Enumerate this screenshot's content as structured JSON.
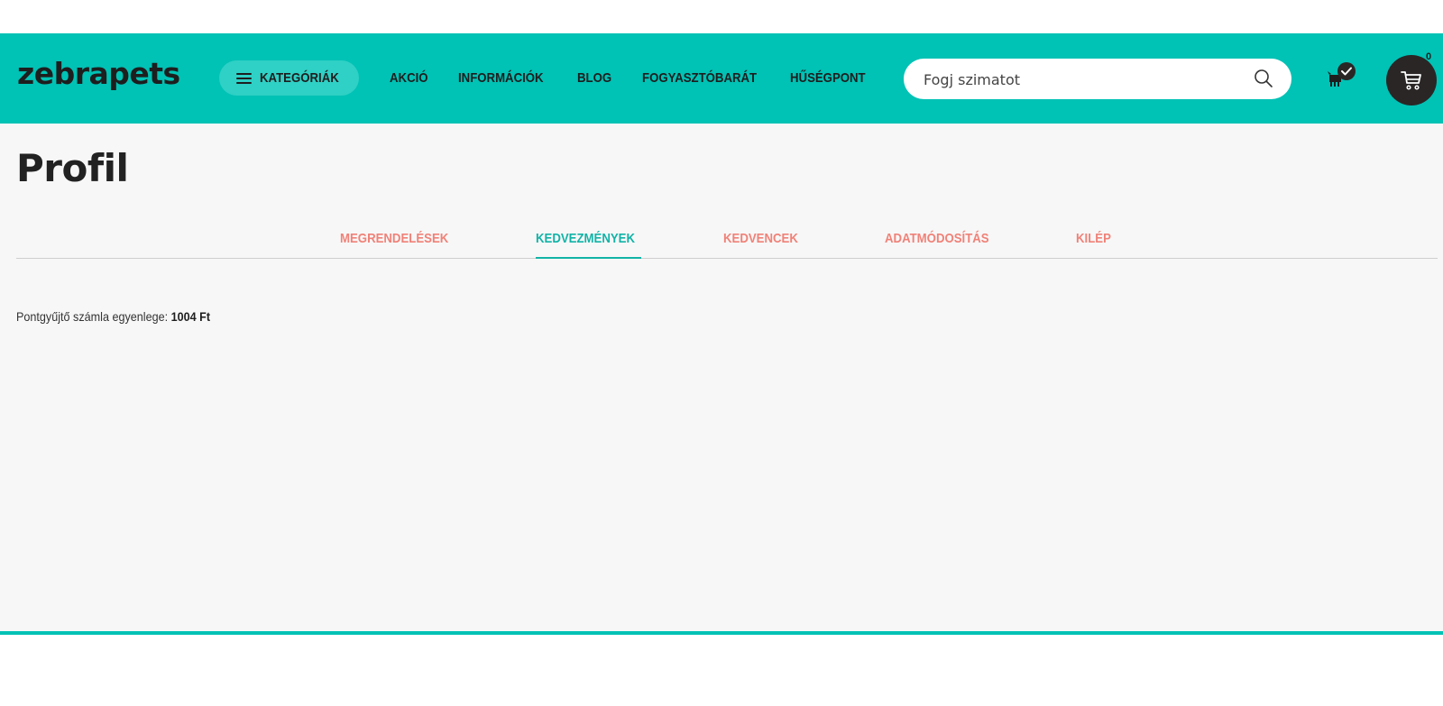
{
  "header": {
    "logo": "zebrapets",
    "categories_label": "KATEGÓRIÁK",
    "nav": [
      "AKCIÓ",
      "INFORMÁCIÓK",
      "BLOG",
      "FOGYASZTÓBARÁT",
      "HŰSÉGPONT"
    ],
    "search_placeholder": "Fogj szimatot",
    "cart_count": "0"
  },
  "profile": {
    "title": "Profil",
    "tabs": [
      "MEGRENDELÉSEK",
      "KEDVEZMÉNYEK",
      "KEDVENCEK",
      "ADATMÓDOSÍTÁS",
      "KILÉP"
    ],
    "active_tab": "KEDVEZMÉNYEK",
    "balance_label": "Pontgyűjtő számla egyenlege: ",
    "balance_value": "1004 Ft"
  },
  "colors": {
    "accent": "#00c2b5",
    "tab_inactive": "#f08278",
    "tab_active": "#12b3a7",
    "dark": "#2a2626"
  },
  "icons": {
    "menu": "hamburger-icon",
    "search": "search-icon",
    "pet": "pet-check-icon",
    "cart": "cart-icon"
  }
}
